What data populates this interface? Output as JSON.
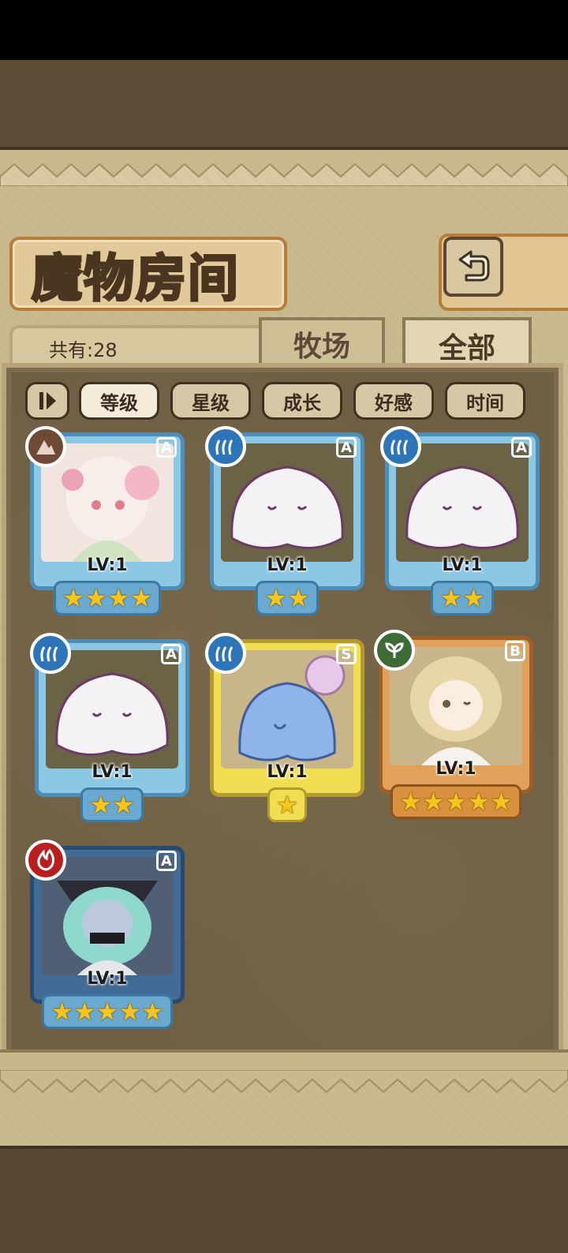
{
  "title": "魔物房间",
  "count_text": "共有:28",
  "tabs": {
    "ranch": "牧场",
    "all": "全部"
  },
  "sort_options": [
    "等级",
    "星级",
    "成长",
    "好感",
    "时间"
  ],
  "active_sort": "等级",
  "monsters": [
    {
      "level": "LV:1",
      "rank": "A",
      "element": "earth",
      "stars": "★★★★",
      "frame": "blue",
      "art": "sakura-girl"
    },
    {
      "level": "LV:1",
      "rank": "A",
      "element": "water",
      "stars": "★★",
      "frame": "blue",
      "art": "white-slime"
    },
    {
      "level": "LV:1",
      "rank": "A",
      "element": "water",
      "stars": "★★",
      "frame": "blue",
      "art": "white-slime"
    },
    {
      "level": "LV:1",
      "rank": "A",
      "element": "water",
      "stars": "★★",
      "frame": "blue",
      "art": "white-slime"
    },
    {
      "level": "LV:1",
      "rank": "S",
      "element": "water",
      "stars": "★",
      "frame": "gold",
      "art": "blue-slime"
    },
    {
      "level": "LV:1",
      "rank": "B",
      "element": "wood",
      "stars": "★★★★★",
      "frame": "orange",
      "art": "blonde-girl"
    },
    {
      "level": "LV:1",
      "rank": "A",
      "element": "fire",
      "stars": "★★★★★",
      "frame": "dark",
      "art": "pirate-girl"
    }
  ],
  "colors": {
    "panel": "#c9b98f",
    "frame_blue": "#8cc7e3",
    "frame_gold": "#f2de53",
    "frame_orange": "#e2a15a",
    "star": "#f5c51e"
  }
}
